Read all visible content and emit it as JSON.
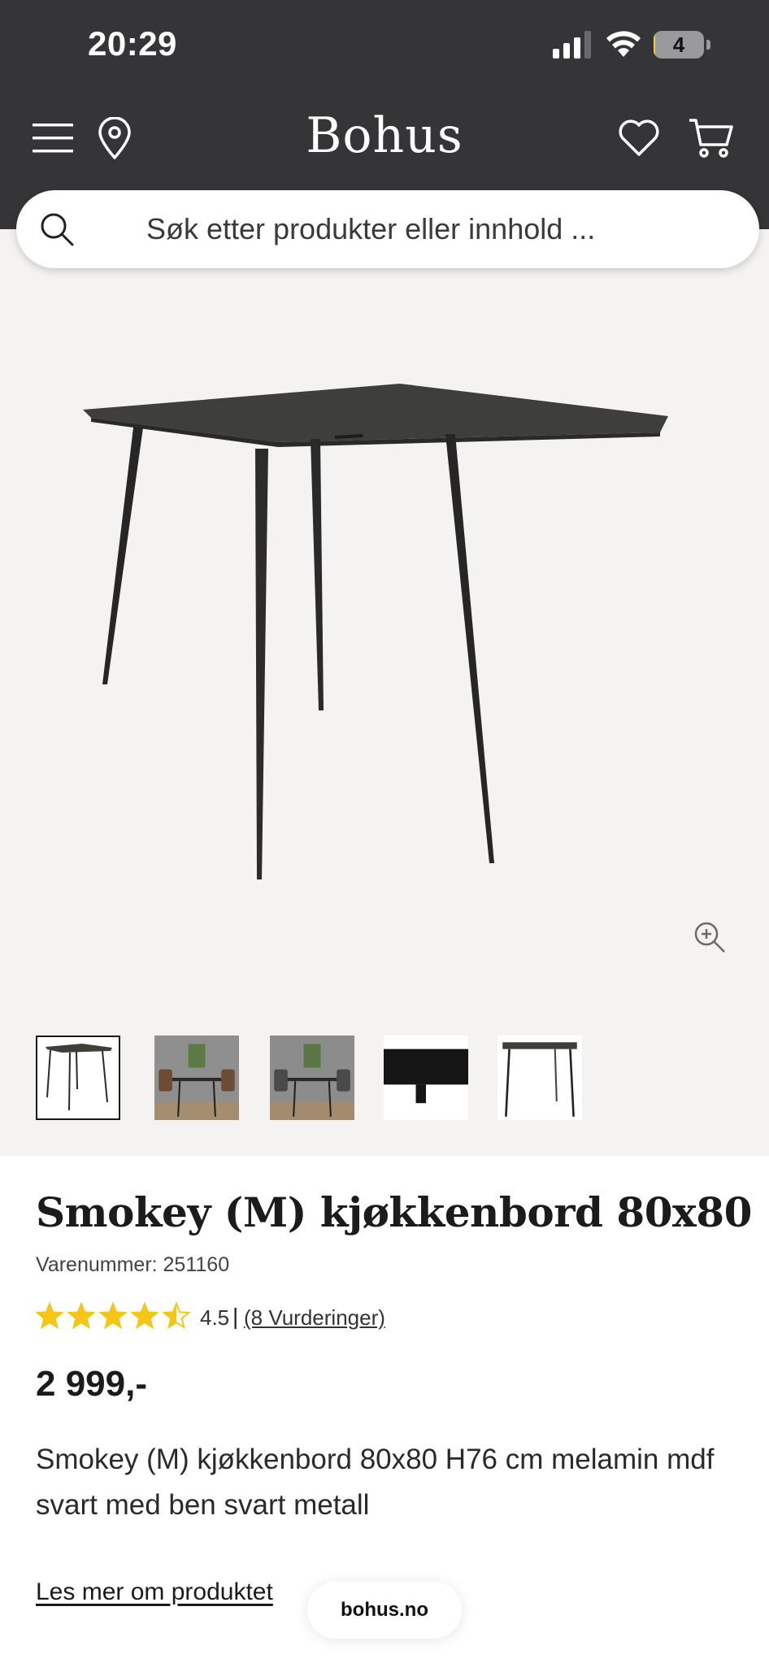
{
  "status_bar": {
    "time": "20:29",
    "battery_level": "4",
    "battery_fraction": 0.04
  },
  "header": {
    "logo": "Bohus",
    "background_color": "#353537"
  },
  "search": {
    "placeholder": "Søk etter produkter eller innhold ..."
  },
  "gallery": {
    "thumbnail_count": 5,
    "active_thumbnail": 1
  },
  "product": {
    "title": "Smokey (M) kjøkkenbord 80x80",
    "sku": "Varenummer: 251160",
    "rating_value": "4.5",
    "rating_score": 4.5,
    "rating_max": 5,
    "rating_separator": "|",
    "rating_count": "(8 Vurderinger)",
    "price": "2 999,-",
    "description": "Smokey (M) kjøkkenbord 80x80 H76 cm melamin mdf svart med ben svart metall",
    "read_more": "Les mer om produktet"
  },
  "browser": {
    "domain": "bohus.no"
  },
  "colors": {
    "star": "#f5c518",
    "gallery_bg": "#f4f3f1"
  }
}
